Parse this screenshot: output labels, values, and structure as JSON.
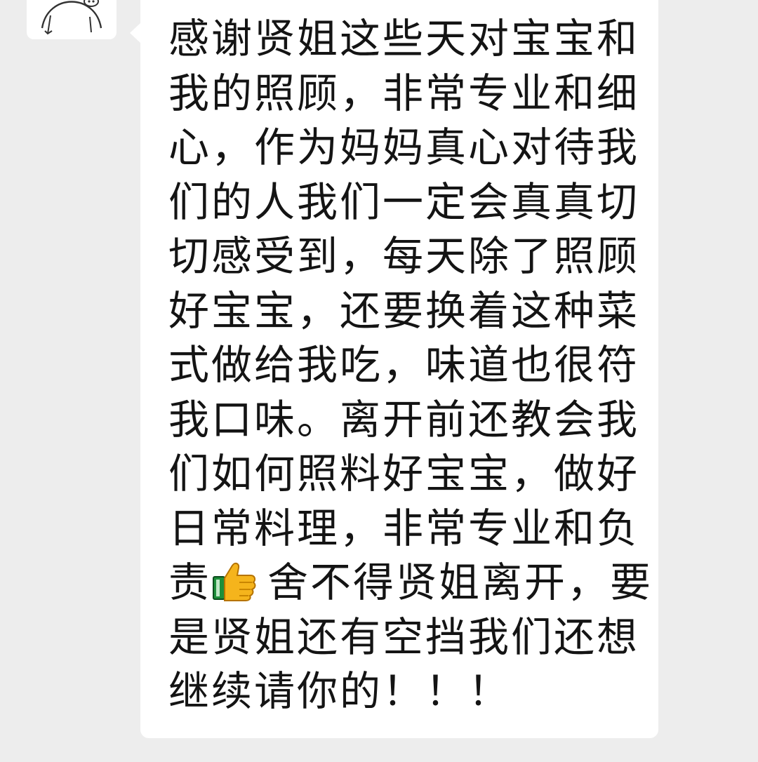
{
  "chat": {
    "avatar_icon": "pig-doodle-icon",
    "message": {
      "lines": [
        "感谢贤姐这些天对宝宝和",
        "我的照顾，非常专业和细",
        "心，作为妈妈真心对待我",
        "们的人我们一定会真真切",
        "切感受到，每天除了照顾",
        "好宝宝，还要换着这种菜",
        "式做给我吃，味道也很符",
        "我口味。离开前还教会我",
        "们如何照料好宝宝，做好",
        "日常料理，非常专业和负",
        "舍不得贤姐离开，要",
        "是贤姐还有空挡我们还想",
        "继续请你的！！！"
      ],
      "line11_prefix": "责",
      "emoji_icon": "thumbs-up-icon"
    }
  },
  "colors": {
    "background": "#ededed",
    "bubble": "#ffffff",
    "text": "#141414"
  }
}
